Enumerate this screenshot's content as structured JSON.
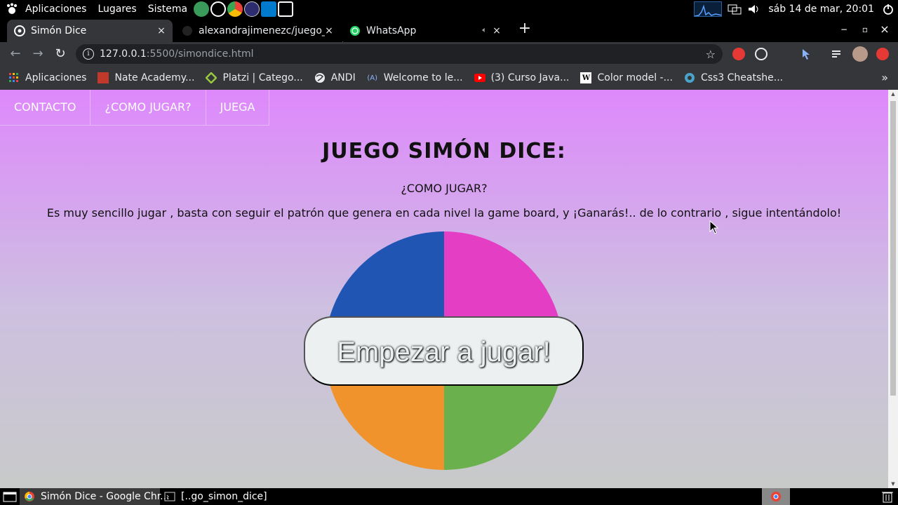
{
  "system_panel": {
    "menus": [
      "Aplicaciones",
      "Lugares",
      "Sistema"
    ],
    "clock": "sáb 14 de mar, 20:01"
  },
  "tabs": [
    {
      "title": "Simón Dice",
      "close": "×"
    },
    {
      "title": "alexandrajimenezc/juego_simon_dice",
      "close": "×"
    },
    {
      "title": "WhatsApp",
      "close": "×"
    }
  ],
  "new_tab": "+",
  "window_controls": {
    "minimize": "−",
    "maximize": "▫",
    "close": "×"
  },
  "address_bar": {
    "host": "127.0.0.1",
    "path": ":5500/simondice.html"
  },
  "bookmarks": [
    {
      "label": "Aplicaciones",
      "icon": "apps-grid-icon"
    },
    {
      "label": "Nate Academy...",
      "icon": "nate-academy-icon"
    },
    {
      "label": "Platzi | Catego...",
      "icon": "platzi-icon"
    },
    {
      "label": "ANDI",
      "icon": "globe-icon"
    },
    {
      "label": "Welcome to le...",
      "icon": "learn-icon"
    },
    {
      "label": "(3) Curso Java...",
      "icon": "youtube-icon"
    },
    {
      "label": "Color model -...",
      "icon": "wikipedia-icon"
    },
    {
      "label": "Css3 Cheatshe...",
      "icon": "cheatsheet-icon"
    }
  ],
  "page": {
    "nav": [
      "CONTACTO",
      "¿COMO JUGAR?",
      "JUEGA"
    ],
    "title": "JUEGO SIMÓN DICE:",
    "how_title": "¿COMO JUGAR?",
    "how_text": "Es muy sencillo jugar , basta con seguir el patrón que genera en cada nivel la game board, y ¡Ganarás!.. de lo contrario , sigue intentándolo!",
    "start_button": "Empezar a jugar!",
    "colors": {
      "celeste": "#2155b4",
      "violeta": "#e33ec4",
      "naranja": "#f0932d",
      "verde": "#6ab04c",
      "start_bg": "#ecf0f1",
      "gradient_top": "#de88fc",
      "gradient_bottom": "#c8cac9"
    }
  },
  "taskbar": {
    "items": [
      "Simón Dice - Google Chr...",
      "[..go_simon_dice]"
    ]
  }
}
